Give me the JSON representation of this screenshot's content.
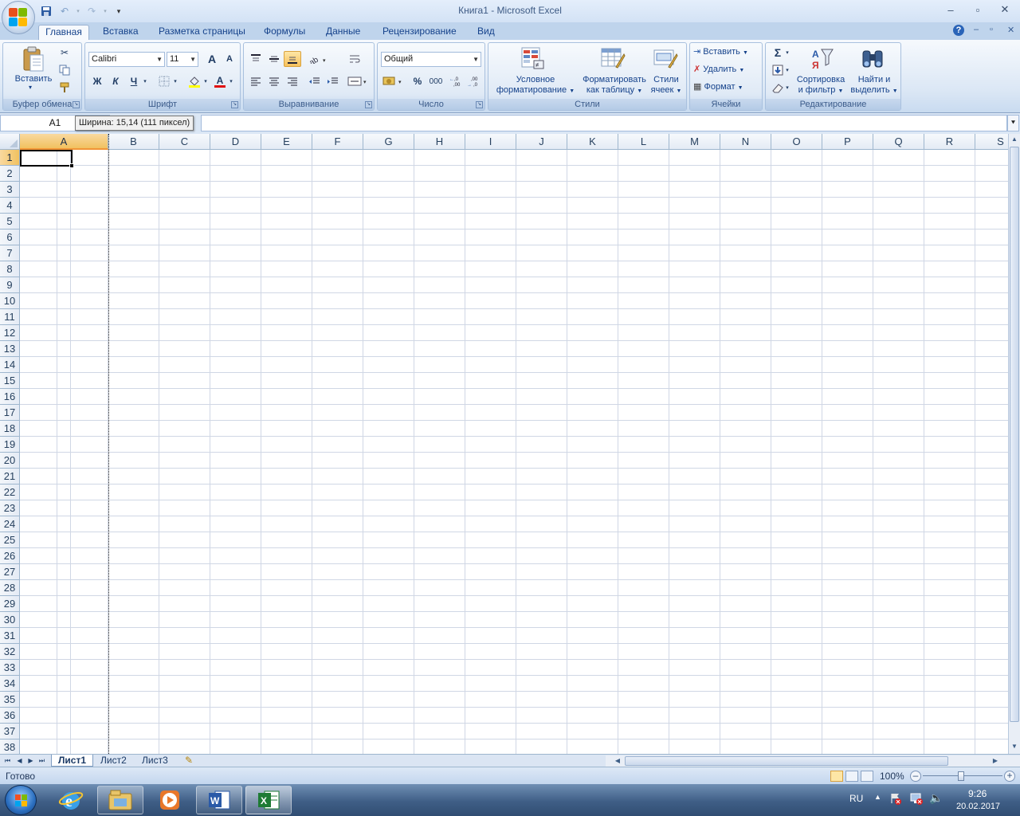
{
  "window": {
    "title": "Книга1 - Microsoft Excel",
    "minimize": "–",
    "maximize": "▫",
    "close": "✕"
  },
  "tabs": [
    "Главная",
    "Вставка",
    "Разметка страницы",
    "Формулы",
    "Данные",
    "Рецензирование",
    "Вид"
  ],
  "tab_corner": {
    "help": "?",
    "minimize": "–",
    "restore": "▫",
    "close": "✕"
  },
  "ribbon": {
    "clipboard": {
      "label": "Буфер обмена",
      "paste": "Вставить"
    },
    "font": {
      "label": "Шрифт",
      "name": "Calibri",
      "size": "11",
      "bold": "Ж",
      "italic": "К",
      "underline": "Ч",
      "grow": "A",
      "shrink": "A",
      "fontcolor_letter": "A"
    },
    "alignment": {
      "label": "Выравнивание"
    },
    "number": {
      "label": "Число",
      "format": "Общий",
      "percent": "%",
      "thousands": "000"
    },
    "styles": {
      "label": "Стили",
      "conditional_line1": "Условное",
      "conditional_line2": "форматирование",
      "table_line1": "Форматировать",
      "table_line2": "как таблицу",
      "cell_line1": "Стили",
      "cell_line2": "ячеек"
    },
    "cells": {
      "label": "Ячейки",
      "insert": "Вставить",
      "delete": "Удалить",
      "format": "Формат"
    },
    "editing": {
      "label": "Редактирование",
      "sum": "Σ",
      "sort_line1": "Сортировка",
      "sort_line2": "и фильтр",
      "find_line1": "Найти и",
      "find_line2": "выделить"
    }
  },
  "formula_bar": {
    "name_box": "A1",
    "tooltip": "Ширина: 15,14 (111 пиксел)",
    "expand": "⯆"
  },
  "grid": {
    "columns": [
      "A",
      "B",
      "C",
      "D",
      "E",
      "F",
      "G",
      "H",
      "I",
      "J",
      "K",
      "L",
      "M",
      "N",
      "O",
      "P",
      "Q",
      "R",
      "S"
    ],
    "rows": [
      "1",
      "2",
      "3",
      "4",
      "5",
      "6",
      "7",
      "8",
      "9",
      "10",
      "11",
      "12",
      "13",
      "14",
      "15",
      "16",
      "17",
      "18",
      "19",
      "20",
      "21",
      "22",
      "23",
      "24",
      "25",
      "26",
      "27",
      "28",
      "29",
      "30",
      "31",
      "32",
      "33",
      "34",
      "35",
      "36",
      "37",
      "38"
    ],
    "selected_column": "A",
    "selected_row": "1"
  },
  "sheets": {
    "tabs": [
      "Лист1",
      "Лист2",
      "Лист3"
    ],
    "active": "Лист1"
  },
  "status": {
    "ready": "Готово",
    "zoom": "100%",
    "zoom_out": "–",
    "zoom_in": "+"
  },
  "taskbar": {
    "lang": "RU",
    "time": "9:26",
    "date": "20.02.2017"
  },
  "colors": {
    "ribbon_text": "#15428b",
    "selected_header": "#f1c15f",
    "excel_green": "#1e7b34"
  }
}
